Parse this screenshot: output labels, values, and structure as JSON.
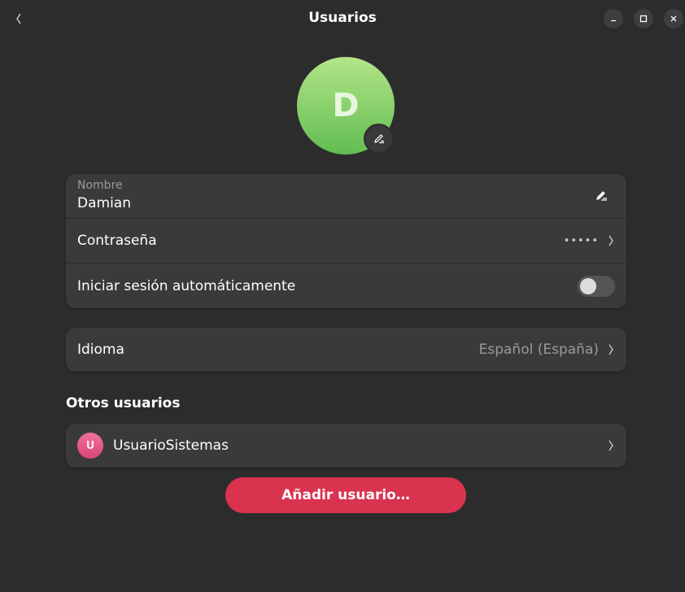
{
  "header": {
    "title": "Usuarios",
    "back_icon": "chevron-left-icon",
    "window_controls": [
      "minimize-icon",
      "maximize-icon",
      "close-icon"
    ]
  },
  "profile": {
    "avatar_initial": "D",
    "avatar_color": "#7fcb63",
    "edit_icon": "pencil-icon"
  },
  "account": {
    "name_caption": "Nombre",
    "name_value": "Damian",
    "password_label": "Contraseña",
    "password_value": "•••••",
    "autologin_label": "Iniciar sesión automáticamente",
    "autologin_enabled": false
  },
  "language": {
    "label": "Idioma",
    "value": "Español (España)"
  },
  "other_users": {
    "title": "Otros usuarios",
    "users": [
      {
        "initial": "U",
        "name": "UsuarioSistemas",
        "color": "#e2558a"
      }
    ]
  },
  "actions": {
    "add_user_label": "Añadir usuario…",
    "add_user_color": "#d9334f"
  }
}
